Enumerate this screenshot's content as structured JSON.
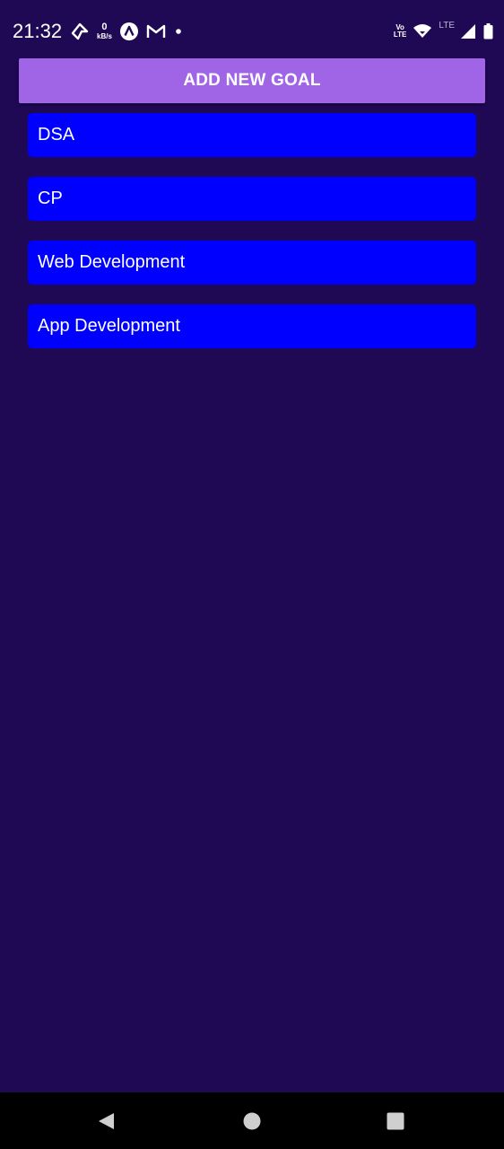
{
  "status_bar": {
    "time": "21:32",
    "net_speed_value": "0",
    "net_speed_unit": "kB/s",
    "volte_top": "Vo",
    "volte_bottom": "LTE",
    "lte_label": "LTE",
    "icons": [
      "navigation-icon",
      "speed-indicator",
      "app-logo-icon",
      "gmail-icon",
      "dot-icon",
      "volte-icon",
      "wifi-icon",
      "signal-icon",
      "battery-icon"
    ]
  },
  "header": {
    "add_button_label": "ADD NEW GOAL"
  },
  "goals": [
    {
      "label": "DSA"
    },
    {
      "label": "CP"
    },
    {
      "label": "Web Development"
    },
    {
      "label": "App Development"
    }
  ],
  "nav_bar": {
    "icons": [
      "back-icon",
      "home-icon",
      "recent-apps-icon"
    ]
  },
  "colors": {
    "background": "#1f0954",
    "button": "#a064e6",
    "goal_item": "#0000ff",
    "nav_bar": "#000000"
  }
}
